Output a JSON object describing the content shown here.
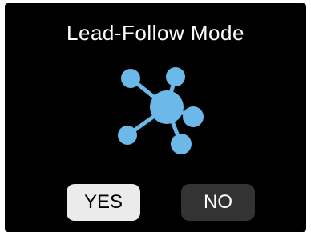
{
  "dialog": {
    "title": "Lead-Follow Mode",
    "icon": "network-hub-icon",
    "buttons": {
      "yes_label": "YES",
      "no_label": "NO"
    }
  },
  "colors": {
    "background": "#000000",
    "accent": "#6cb8e8",
    "yes_button_bg": "#ebebeb",
    "no_button_bg": "#333333"
  }
}
